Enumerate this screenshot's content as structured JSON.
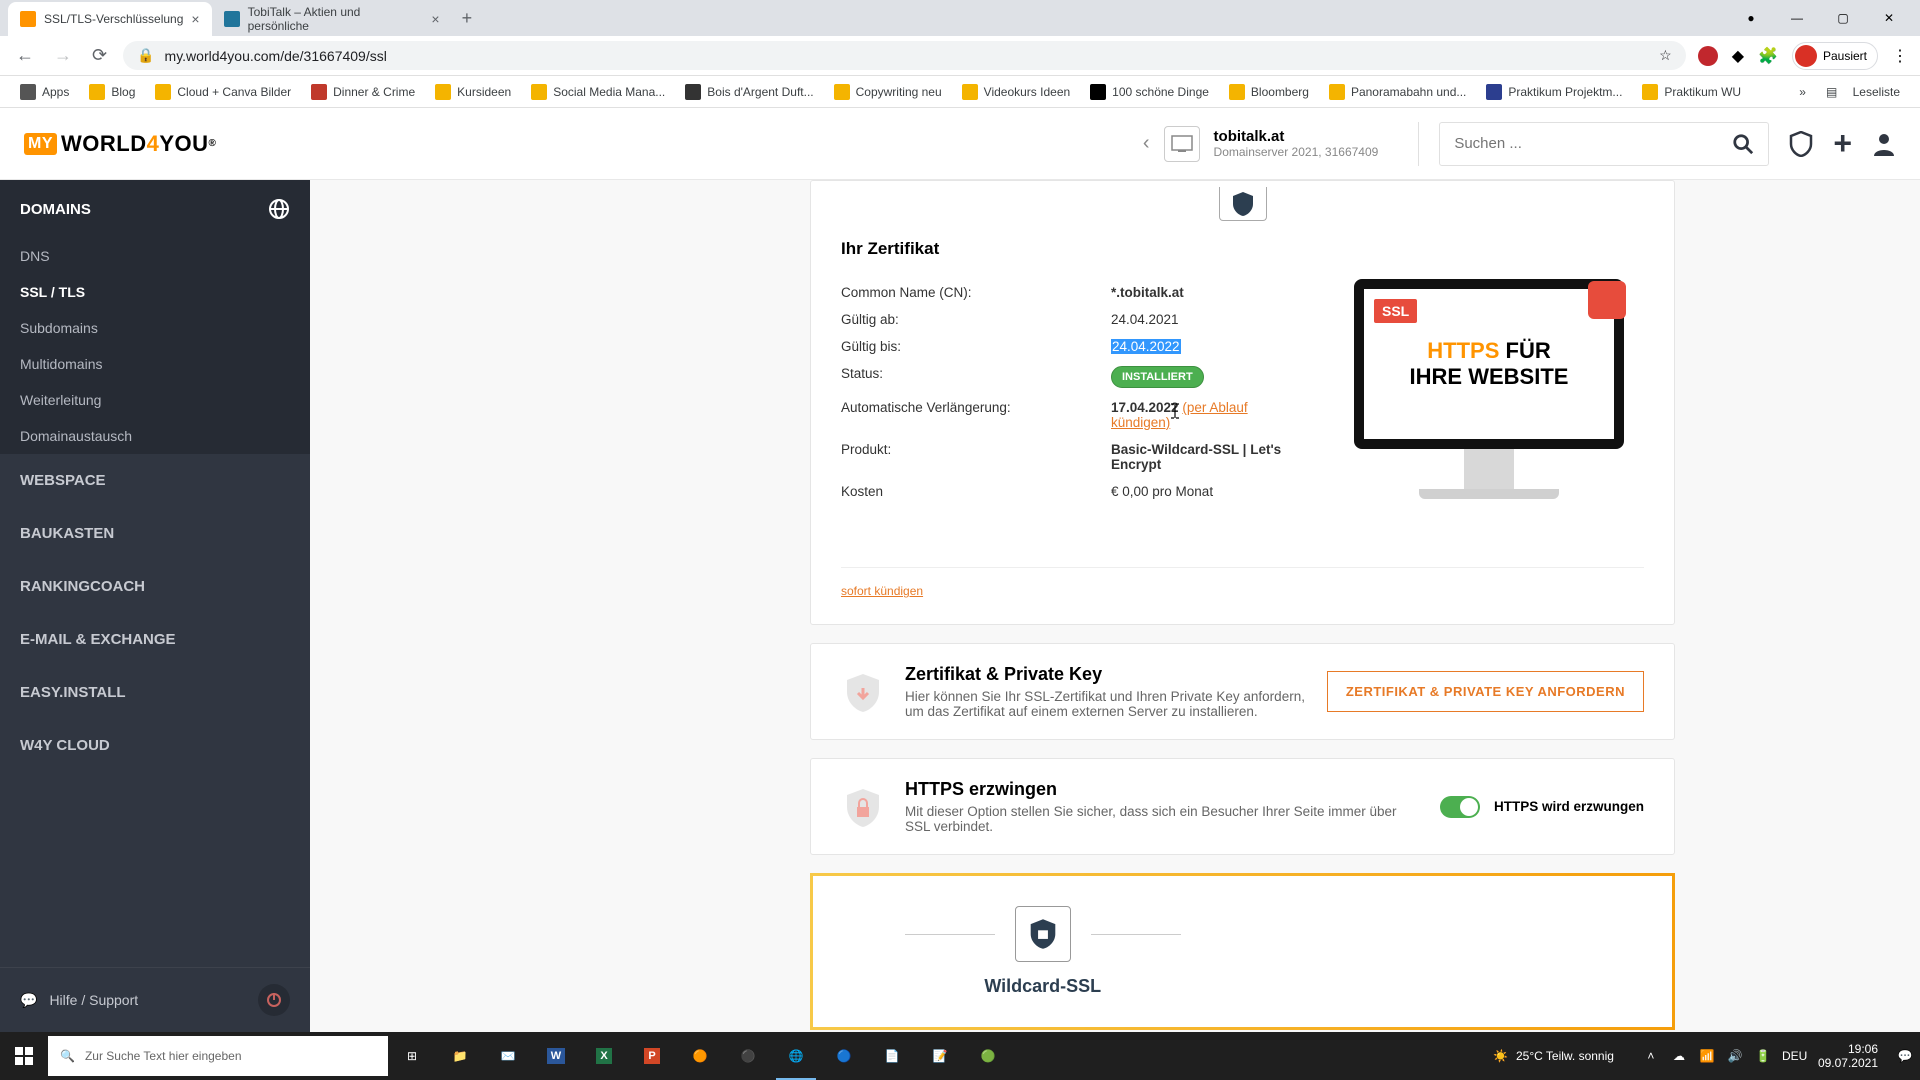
{
  "browser": {
    "tabs": [
      {
        "title": "SSL/TLS-Verschlüsselung",
        "active": true
      },
      {
        "title": "TobiTalk – Aktien und persönliche",
        "active": false
      }
    ],
    "profile_label": "Pausiert",
    "url": "my.world4you.com/de/31667409/ssl",
    "bookmarks": [
      "Apps",
      "Blog",
      "Cloud + Canva Bilder",
      "Dinner & Crime",
      "Kursideen",
      "Social Media Mana...",
      "Bois d'Argent Duft...",
      "Copywriting neu",
      "Videokurs Ideen",
      "100 schöne Dinge",
      "Bloomberg",
      "Panoramabahn und...",
      "Praktikum Projektm...",
      "Praktikum WU"
    ],
    "bookmarks_more": "»",
    "reading_list": "Leseliste"
  },
  "header": {
    "domain_name": "tobitalk.at",
    "domain_sub": "Domainserver 2021, 31667409",
    "search_placeholder": "Suchen ..."
  },
  "sidebar": {
    "sections": {
      "domains": "DOMAINS",
      "webspace": "WEBSPACE",
      "baukasten": "BAUKASTEN",
      "rankingcoach": "RANKINGCOACH",
      "email": "E-MAIL & EXCHANGE",
      "easyinstall": "EASY.INSTALL",
      "w4ycloud": "W4Y CLOUD"
    },
    "domain_items": [
      "DNS",
      "SSL / TLS",
      "Subdomains",
      "Multidomains",
      "Weiterleitung",
      "Domainaustausch"
    ],
    "help": "Hilfe / Support"
  },
  "cert": {
    "title": "Ihr Zertifikat",
    "labels": {
      "cn": "Common Name (CN):",
      "from": "Gültig ab:",
      "to": "Gültig bis:",
      "status": "Status:",
      "renew": "Automatische Verlängerung:",
      "product": "Produkt:",
      "cost": "Kosten"
    },
    "values": {
      "cn": "*.tobitalk.at",
      "from": "24.04.2021",
      "to": "24.04.2022",
      "status": "INSTALLIERT",
      "renew_date": "17.04.2022",
      "renew_link": "(per Ablauf kündigen)",
      "product": "Basic-Wildcard-SSL | Let's Encrypt",
      "cost": "€ 0,00 pro Monat"
    },
    "cancel": "sofort kündigen",
    "illustration": {
      "ssl": "SSL",
      "line1_a": "HTTPS",
      "line1_b": " FÜR",
      "line2": "IHRE WEBSITE"
    }
  },
  "sections": {
    "privkey": {
      "title": "Zertifikat & Private Key",
      "desc": "Hier können Sie Ihr SSL-Zertifikat und Ihren Private Key anfordern, um das Zertifikat auf einem externen Server zu installieren.",
      "button": "ZERTIFIKAT & PRIVATE KEY ANFORDERN"
    },
    "https": {
      "title": "HTTPS erzwingen",
      "desc": "Mit dieser Option stellen Sie sicher, dass sich ein Besucher Ihrer Seite immer über SSL verbindet.",
      "toggle_label": "HTTPS wird erzwungen"
    },
    "promo": {
      "title": "Wildcard-SSL"
    }
  },
  "taskbar": {
    "search_placeholder": "Zur Suche Text hier eingeben",
    "weather": "25°C  Teilw. sonnig",
    "lang": "DEU",
    "time": "19:06",
    "date": "09.07.2021"
  }
}
